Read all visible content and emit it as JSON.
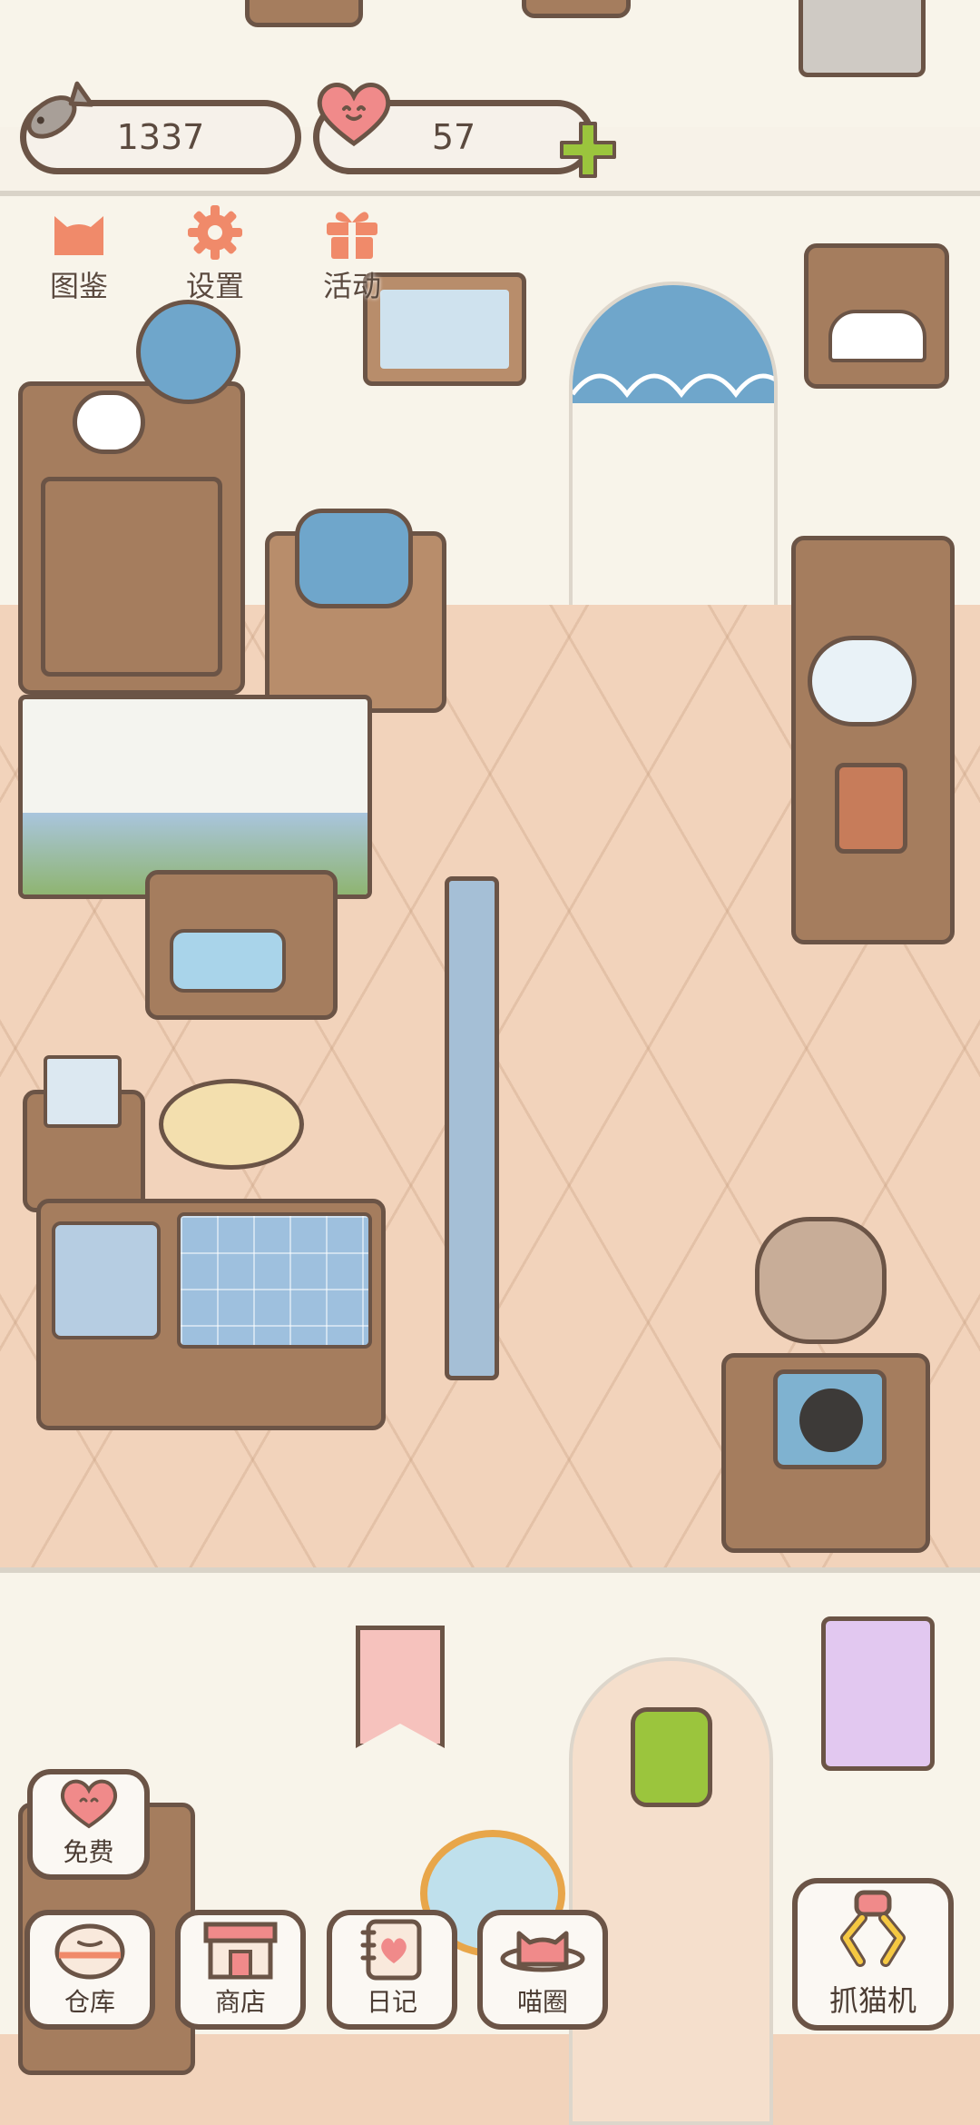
{
  "currency": {
    "fish": {
      "icon": "fish-icon",
      "value": "1337"
    },
    "hearts": {
      "icon": "heart-icon",
      "value": "57",
      "add_icon": "plus-icon"
    }
  },
  "top_menu": [
    {
      "name": "图鉴",
      "icon": "cat-head-icon"
    },
    {
      "name": "设置",
      "icon": "gear-icon"
    },
    {
      "name": "活动",
      "icon": "gift-icon"
    }
  ],
  "bottom_menu": {
    "free": {
      "label": "免费",
      "icon": "heart-face-icon"
    },
    "items": [
      {
        "label": "仓库",
        "icon": "storage-bun-icon"
      },
      {
        "label": "商店",
        "icon": "shop-icon"
      },
      {
        "label": "日记",
        "icon": "diary-icon"
      },
      {
        "label": "喵圈",
        "icon": "cat-planet-icon"
      }
    ],
    "claw": {
      "label": "抓猫机",
      "icon": "claw-machine-icon"
    }
  },
  "colors": {
    "accent_orange": "#f08a6a",
    "plus_green": "#9bc53d",
    "outline_brown": "#6b5446",
    "floor": "#f2d3bb",
    "wall": "#f8f4ea"
  }
}
